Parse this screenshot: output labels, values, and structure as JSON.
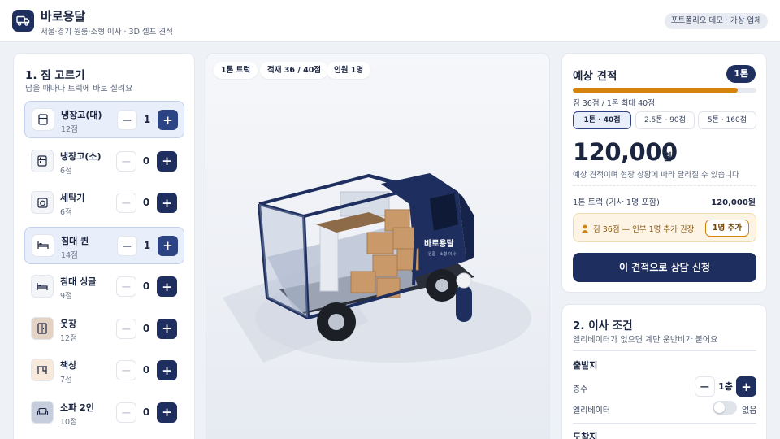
{
  "header": {
    "title": "바로용달",
    "subtitle": "서울·경기 원룸·소형 이사 · 3D 셀프 견적",
    "badge": "포트폴리오 데모 · 가상 업체"
  },
  "left": {
    "title": "1. 짐 고르기",
    "subtitle": "담을 때마다 트럭에 바로 실려요",
    "items": [
      {
        "name": "냉장고(대)",
        "count": "12점",
        "qty": "1",
        "icon": "fridge-icon"
      },
      {
        "name": "냉장고(소)",
        "count": "6점",
        "qty": "0",
        "icon": "fridge-icon"
      },
      {
        "name": "세탁기",
        "count": "6점",
        "qty": "0",
        "icon": "washer-icon"
      },
      {
        "name": "침대 퀸",
        "count": "14점",
        "qty": "1",
        "icon": "bed-icon"
      },
      {
        "name": "침대 싱글",
        "count": "9점",
        "qty": "0",
        "icon": "bed-icon"
      },
      {
        "name": "옷장",
        "count": "12점",
        "qty": "0",
        "icon": "wardrobe-icon"
      },
      {
        "name": "책상",
        "count": "7점",
        "qty": "0",
        "icon": "desk-icon"
      },
      {
        "name": "소파 2인",
        "count": "10점",
        "qty": "0",
        "icon": "sofa-icon"
      }
    ],
    "minus_symbol": "−",
    "plus_symbol": "+"
  },
  "center": {
    "chips": [
      "1톤 트럭",
      "적재 36 / 40점",
      "인원 1명"
    ],
    "truck_label": "바로용달",
    "truck_sublabel": "원룸 · 소형 이사",
    "load_fraction": 0.9
  },
  "estimate": {
    "title": "예상 견적",
    "truck_badge": "1톤",
    "load_text": "짐 36점 / 1톤 최대 40점",
    "load_fraction": 0.9,
    "options": [
      "1톤 · 40점",
      "2.5톤 · 90점",
      "5톤 · 160점"
    ],
    "selected_option": 0,
    "price": "120,000",
    "price_unit": "원",
    "price_note": "예상 견적이며 현장 상황에 따라 달라질 수 있습니다",
    "line_label": "1톤 트럭 (기사 1명 포함)",
    "line_value": "120,000원",
    "warning": "짐 36점 — 인부 1명 추가 권장",
    "warning_button": "1명 추가",
    "cta": "이 견적으로 상담 신청"
  },
  "conditions": {
    "title": "2. 이사 조건",
    "subtitle": "엘리베이터가 없으면 계단 운반비가 붙어요",
    "origin_title": "출발지",
    "floor_label": "층수",
    "floor_value": "1층",
    "elevator_label": "엘리베이터",
    "elevator_value": "없음",
    "destination_title": "도착지"
  },
  "colors": {
    "navy": "#1e2f5f",
    "accent_orange": "#d4840c",
    "selected_bg": "#e8eefa"
  }
}
